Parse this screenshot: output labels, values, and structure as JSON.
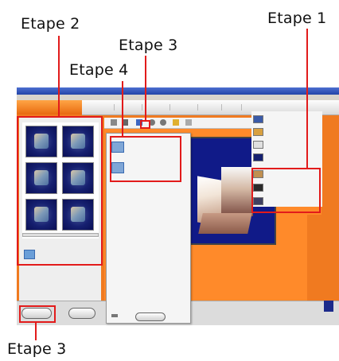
{
  "annotations": {
    "step1": "Etape 1",
    "step2": "Etape 2",
    "step3_top": "Etape 3",
    "step4": "Etape 4",
    "step3_bottom": "Etape 3"
  },
  "colors": {
    "annotation": "#e21b1b",
    "app_background": "#f07a20",
    "preview_background": "#101a88"
  },
  "icons": {
    "thumbnails": "photo-thumbnail-icon",
    "add_photos": "add-photos-icon",
    "effects": "effect-icon",
    "show_more": "show-more-icon",
    "popup_items": "menu-option-icon"
  }
}
